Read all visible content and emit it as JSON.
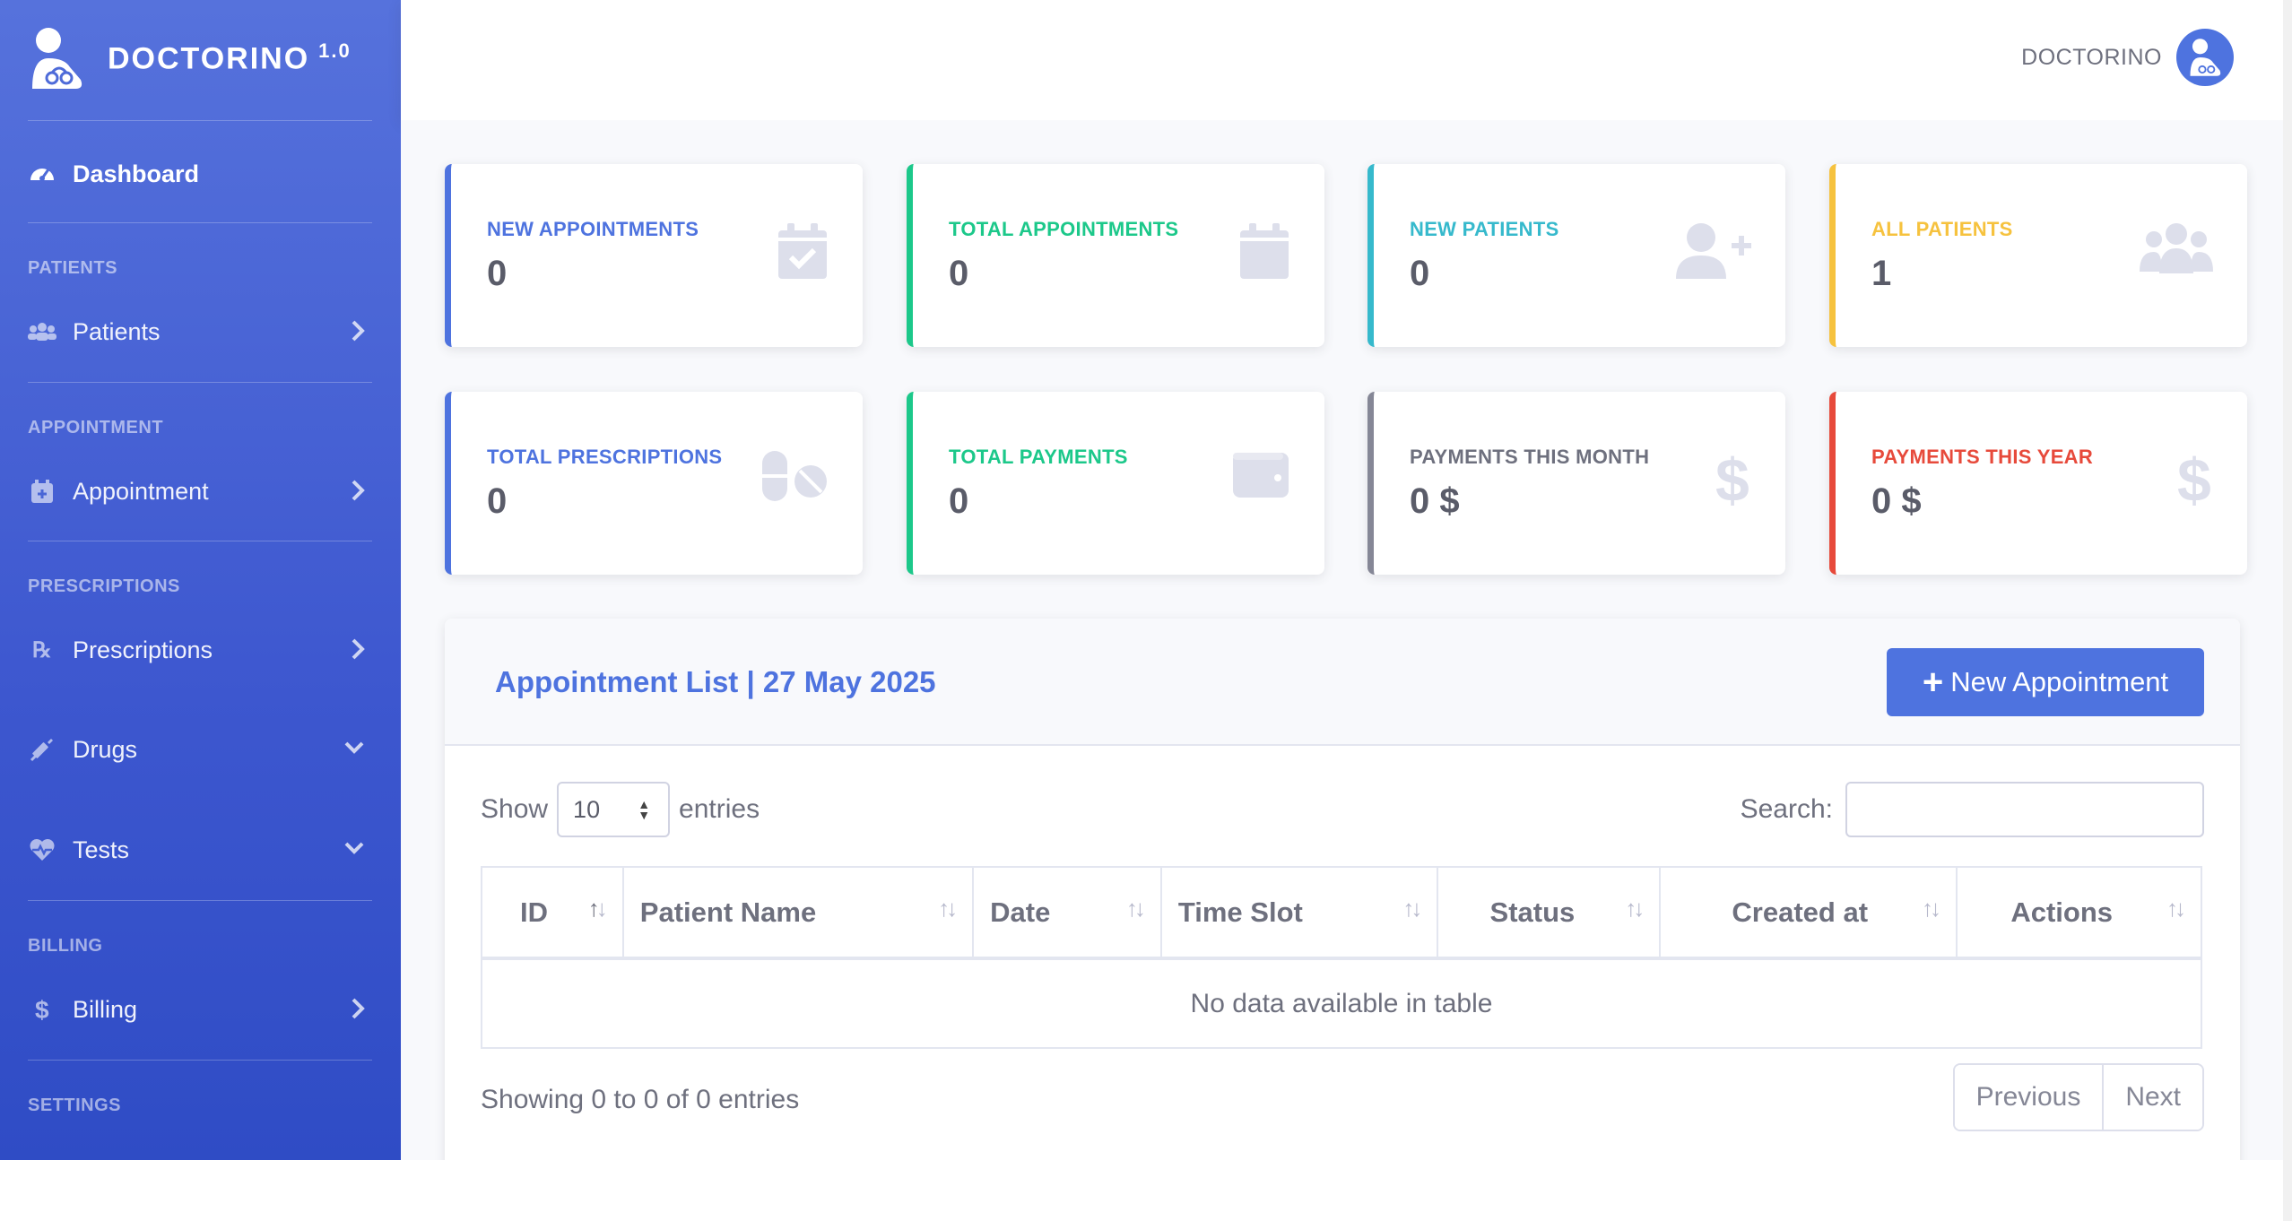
{
  "brand": {
    "name": "DOCTORINO",
    "version": "1.0"
  },
  "sidebar": {
    "dashboard": "Dashboard",
    "headings": {
      "patients": "PATIENTS",
      "appointment": "APPOINTMENT",
      "prescriptions": "PRESCRIPTIONS",
      "billing": "BILLING",
      "settings": "SETTINGS"
    },
    "items": {
      "patients": "Patients",
      "appointment": "Appointment",
      "prescriptions": "Prescriptions",
      "drugs": "Drugs",
      "tests": "Tests",
      "billing": "Billing"
    }
  },
  "topbar": {
    "user": "DOCTORINO"
  },
  "cards": [
    {
      "title": "NEW APPOINTMENTS",
      "value": "0",
      "color": "#4e73df",
      "icon": "calendar-check-icon"
    },
    {
      "title": "TOTAL APPOINTMENTS",
      "value": "0",
      "color": "#1cc88a",
      "icon": "calendar-icon"
    },
    {
      "title": "NEW PATIENTS",
      "value": "0",
      "color": "#36b9cc",
      "icon": "user-plus-icon"
    },
    {
      "title": "ALL PATIENTS",
      "value": "1",
      "color": "#f6c23e",
      "icon": "users-icon"
    },
    {
      "title": "TOTAL PRESCRIPTIONS",
      "value": "0",
      "color": "#4e73df",
      "icon": "pills-icon"
    },
    {
      "title": "TOTAL PAYMENTS",
      "value": "0",
      "color": "#1cc88a",
      "icon": "wallet-icon"
    },
    {
      "title": "PAYMENTS THIS MONTH",
      "value": "0 $",
      "color": "#858796",
      "icon": "dollar-icon"
    },
    {
      "title": "PAYMENTS THIS YEAR",
      "value": "0 $",
      "color": "#e74a3b",
      "icon": "dollar-icon"
    }
  ],
  "appointments": {
    "title": "Appointment List | 27 May 2025",
    "new_button": "New Appointment",
    "length": {
      "show": "Show",
      "value": "10",
      "entries": "entries"
    },
    "search_label": "Search:",
    "columns": [
      "ID",
      "Patient Name",
      "Date",
      "Time Slot",
      "Status",
      "Created at",
      "Actions"
    ],
    "empty": "No data available in table",
    "info": "Showing 0 to 0 of 0 entries",
    "prev": "Previous",
    "next": "Next"
  }
}
